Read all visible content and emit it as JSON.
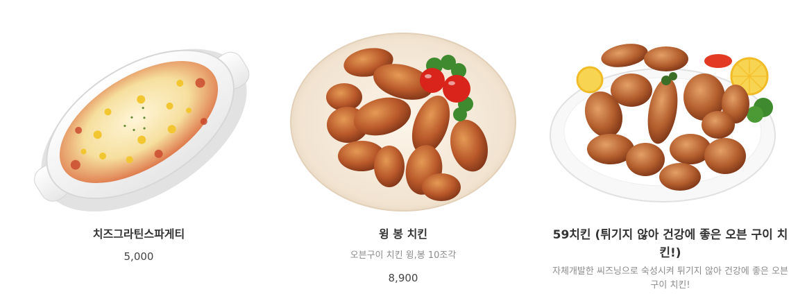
{
  "menu": {
    "items": [
      {
        "name": "치즈그라틴스파게티",
        "price": "5,000",
        "image": "gratin-spaghetti-photo"
      },
      {
        "name": "윙 봉 치킨",
        "description": "오븐구이 치킨 윙,봉 10조각",
        "price": "8,900",
        "image": "wing-bong-chicken-photo"
      },
      {
        "name": "59치킨 (튀기지 않아 건강에 좋은 오븐 구이 치킨!)",
        "description": "자체개발한 씨즈닝으로 숙성시켜 튀기지 않아 건강에 좋은 오븐 구이 치킨!",
        "image": "oven-roasted-chicken-photo"
      }
    ]
  },
  "colors": {
    "title_text": "#333333",
    "description_text": "#8b8b8b",
    "price_text": "#444444",
    "background": "#ffffff"
  }
}
